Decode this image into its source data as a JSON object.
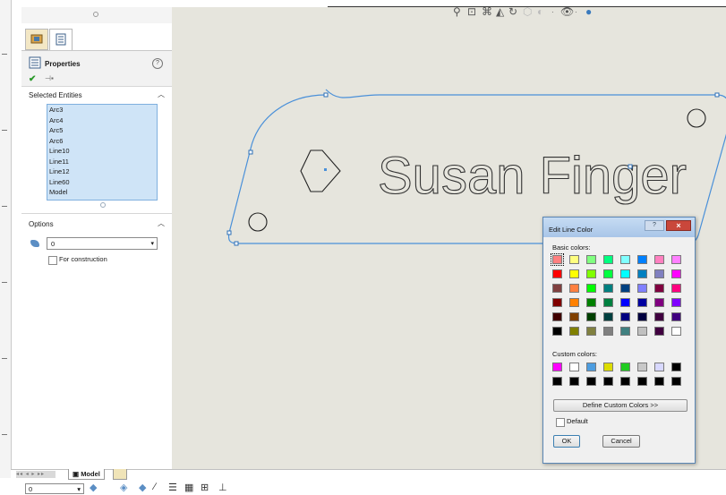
{
  "property_manager": {
    "title": "Properties",
    "sections": {
      "selected_entities": {
        "title": "Selected Entities",
        "items": [
          "Arc3",
          "Arc4",
          "Arc5",
          "Arc6",
          "Line10",
          "Line11",
          "Line12",
          "Line60",
          "Model"
        ]
      },
      "options": {
        "title": "Options",
        "layer_value": "0",
        "for_construction_label": "For construction"
      }
    }
  },
  "canvas": {
    "sketch_text": "Susan Finger",
    "sketch_color": "#4a90d9"
  },
  "edit_line_color_dialog": {
    "title": "Edit Line Color",
    "help_label": "?",
    "close_label": "×",
    "basic_colors_label": "Basic colors:",
    "custom_colors_label": "Custom colors:",
    "define_custom_label": "Define Custom Colors >>",
    "default_label": "Default",
    "ok_label": "OK",
    "cancel_label": "Cancel",
    "selected_color": "#ff8080",
    "basic_colors": [
      [
        "#ff8080",
        "#ffff80",
        "#80ff80",
        "#00ff80",
        "#80ffff",
        "#0080ff",
        "#ff80c0",
        "#ff80ff"
      ],
      [
        "#ff0000",
        "#ffff00",
        "#80ff00",
        "#00ff40",
        "#00ffff",
        "#0080c0",
        "#8080c0",
        "#ff00ff"
      ],
      [
        "#804040",
        "#ff8040",
        "#00ff00",
        "#008080",
        "#004080",
        "#8080ff",
        "#800040",
        "#ff0080"
      ],
      [
        "#800000",
        "#ff8000",
        "#008000",
        "#008040",
        "#0000ff",
        "#0000a0",
        "#800080",
        "#8000ff"
      ],
      [
        "#400000",
        "#804000",
        "#004000",
        "#004040",
        "#000080",
        "#000040",
        "#400040",
        "#400080"
      ],
      [
        "#000000",
        "#808000",
        "#808040",
        "#808080",
        "#408080",
        "#c0c0c0",
        "#400040",
        "#ffffff"
      ]
    ],
    "custom_colors": [
      [
        "#ff00ff",
        "#ffffff",
        "#4d9de0",
        "#dddd00",
        "#22cc22",
        "#c8c8c8",
        "#d8d8ff",
        "#000000"
      ],
      [
        "#000000",
        "#000000",
        "#000000",
        "#000000",
        "#000000",
        "#000000",
        "#000000",
        "#000000"
      ]
    ]
  },
  "bottom": {
    "tab_model": "Model",
    "layer_value": "0"
  }
}
